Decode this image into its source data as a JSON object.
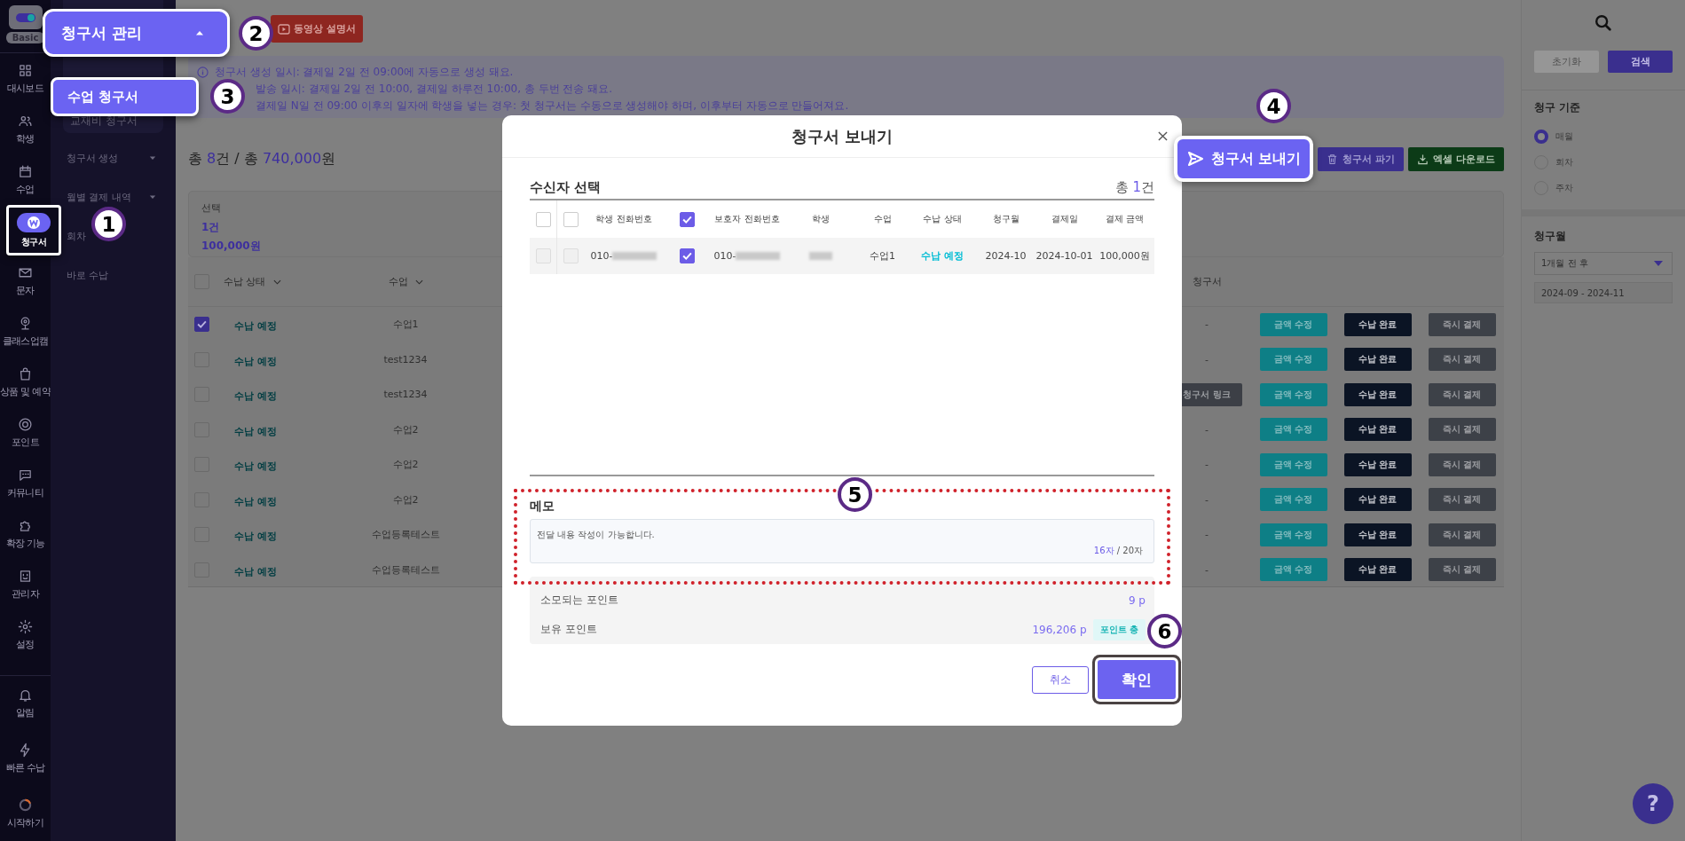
{
  "nav_rail": {
    "plan": "Basic",
    "items": [
      {
        "label": "대시보드",
        "selected": false
      },
      {
        "label": "학생",
        "selected": false
      },
      {
        "label": "수업",
        "selected": false
      },
      {
        "label": "청구서",
        "selected": true
      },
      {
        "label": "문자",
        "selected": false
      },
      {
        "label": "클래스업캠",
        "selected": false
      },
      {
        "label": "상품 및 예약",
        "selected": false
      },
      {
        "label": "포인트",
        "selected": false
      },
      {
        "label": "커뮤니티",
        "selected": false
      },
      {
        "label": "확장 기능",
        "selected": false
      },
      {
        "label": "관리자",
        "selected": false
      },
      {
        "label": "설정",
        "selected": false
      }
    ],
    "bottom_items": [
      {
        "label": "알림"
      },
      {
        "label": "빠른 수납"
      },
      {
        "label": "시작하기"
      }
    ]
  },
  "submenu": {
    "group": {
      "label": "청구서 관리",
      "expanded": true,
      "highlighted": true,
      "children": [
        {
          "label": "수업 청구서",
          "selected": true
        },
        {
          "label": "교재비 청구서",
          "selected": false
        }
      ]
    },
    "items": [
      {
        "label": "청구서 생성",
        "kind": "dropdown"
      },
      {
        "label": "월별 결제 내역",
        "kind": "dropdown"
      },
      {
        "label": "회차",
        "kind": "link"
      },
      {
        "label": "바로 수납",
        "kind": "link"
      }
    ]
  },
  "page": {
    "video_button": "동영상 설명서",
    "info_lines": [
      "청구서 생성 일시: 결제일 2일 전 09:00에 자동으로 생성 돼요.",
      "발송 일시: 결제일 2일 전 10:00, 결제일 하루전 10:00, 총 두번 전송 돼요.",
      "결제일 N일 전 09:00 이후의 일자에 학생을 넣는 경우: 첫 청구서는 수동으로 생성해야 하며, 이후부터 자동으로 만들어져요."
    ],
    "summary": [
      {
        "text": "총 ",
        "accent": false
      },
      {
        "text": "8",
        "accent": true
      },
      {
        "text": "건 / 총 ",
        "accent": false
      },
      {
        "text": "740,000",
        "accent": true
      },
      {
        "text": "원",
        "accent": false
      }
    ],
    "actions": [
      {
        "label": "청구서 보내기",
        "kind": "send",
        "highlighted": true
      },
      {
        "label": "청구서 파기",
        "kind": "delete",
        "highlighted": false
      },
      {
        "label": "엑셀 다운로드",
        "kind": "excel",
        "highlighted": false
      }
    ],
    "selection": {
      "title": "선택",
      "count": "1건",
      "amount": "100,000원"
    },
    "table": {
      "all_checked": false,
      "columns": [
        {
          "label": "수납 상태",
          "sortable": true
        },
        {
          "label": "수업",
          "sortable": true
        },
        {
          "label": "청구서",
          "sortable": false
        }
      ],
      "rows": [
        {
          "checked": true,
          "status": "수납 예정",
          "class": "수업1",
          "invoice": {
            "kind": "text",
            "text": "-"
          },
          "actions": [
            "금액 수정",
            "수납 완료",
            "즉시 결제"
          ]
        },
        {
          "checked": false,
          "status": "수납 예정",
          "class": "test1234",
          "invoice": {
            "kind": "text",
            "text": "-"
          },
          "actions": [
            "금액 수정",
            "수납 완료",
            "즉시 결제"
          ]
        },
        {
          "checked": false,
          "status": "수납 예정",
          "class": "test1234",
          "invoice": {
            "kind": "button",
            "text": "청구서 링크"
          },
          "actions": [
            "금액 수정",
            "수납 완료",
            "즉시 결제"
          ]
        },
        {
          "checked": false,
          "status": "수납 예정",
          "class": "수업2",
          "invoice": {
            "kind": "text",
            "text": "-"
          },
          "actions": [
            "금액 수정",
            "수납 완료",
            "즉시 결제"
          ]
        },
        {
          "checked": false,
          "status": "수납 예정",
          "class": "수업2",
          "invoice": {
            "kind": "text",
            "text": "-"
          },
          "actions": [
            "금액 수정",
            "수납 완료",
            "즉시 결제"
          ]
        },
        {
          "checked": false,
          "status": "수납 예정",
          "class": "수업2",
          "invoice": {
            "kind": "text",
            "text": "-"
          },
          "actions": [
            "금액 수정",
            "수납 완료",
            "즉시 결제"
          ]
        },
        {
          "checked": false,
          "status": "수납 예정",
          "class": "수업등록테스트",
          "invoice": {
            "kind": "text",
            "text": "-"
          },
          "actions": [
            "금액 수정",
            "수납 완료",
            "즉시 결제"
          ]
        },
        {
          "checked": false,
          "status": "수납 예정",
          "class": "수업등록테스트",
          "invoice": {
            "kind": "text",
            "text": "-"
          },
          "actions": [
            "금액 수정",
            "수납 완료",
            "즉시 결제"
          ]
        }
      ]
    }
  },
  "filters": {
    "reset": {
      "label": "초기화",
      "disabled": true
    },
    "search": "검색",
    "basis_title": "청구 기준",
    "basis_options": [
      {
        "label": "매월",
        "selected": true
      },
      {
        "label": "회차",
        "selected": false
      },
      {
        "label": "주차",
        "selected": false
      }
    ],
    "month_title": "청구월",
    "month_select": "1개월 전 후",
    "month_range": "2024-09 - 2024-11"
  },
  "modal": {
    "title": "청구서 보내기",
    "section_title": "수신자 선택",
    "total": [
      {
        "text": "총 ",
        "accent": false
      },
      {
        "text": "1",
        "accent": true
      },
      {
        "text": "건",
        "accent": false
      }
    ],
    "columns": [
      {
        "kind": "checkbox",
        "checked": false
      },
      {
        "kind": "checkbox",
        "checked": false
      },
      {
        "kind": "text",
        "label": "학생 전화번호"
      },
      {
        "kind": "checkbox",
        "checked": true
      },
      {
        "kind": "text",
        "label": "보호자 전화번호"
      },
      {
        "kind": "text",
        "label": "학생"
      },
      {
        "kind": "text",
        "label": "수업"
      },
      {
        "kind": "text",
        "label": "수납 상태"
      },
      {
        "kind": "text",
        "label": "청구월"
      },
      {
        "kind": "text",
        "label": "결제일"
      },
      {
        "kind": "text",
        "label": "결제 금액"
      }
    ],
    "rows": [
      [
        {
          "kind": "checkbox",
          "checked": false
        },
        {
          "kind": "checkbox",
          "checked": false
        },
        {
          "kind": "masked",
          "text": "010-"
        },
        {
          "kind": "checkbox",
          "checked": true
        },
        {
          "kind": "masked",
          "text": "010-"
        },
        {
          "kind": "masked"
        },
        {
          "kind": "text",
          "text": "수업1"
        },
        {
          "kind": "status",
          "text": "수납 예정"
        },
        {
          "kind": "text",
          "text": "2024-10"
        },
        {
          "kind": "text",
          "text": "2024-10-01"
        },
        {
          "kind": "text",
          "text": "100,000원"
        }
      ]
    ],
    "memo": {
      "label": "메모",
      "value": "전달 내용 작성이 가능합니다.",
      "used": "16자",
      "max": "/ 20자",
      "highlighted": true
    },
    "points": [
      {
        "label": "소모되는 포인트",
        "value": "9 p"
      },
      {
        "label": "보유 포인트",
        "value": "196,206 p",
        "button": "포인트 충"
      }
    ],
    "buttons": [
      {
        "label": "취소",
        "kind": "secondary",
        "highlighted": false
      },
      {
        "label": "확인",
        "kind": "primary",
        "highlighted": true
      }
    ]
  },
  "annotations": {
    "badges": [
      "1",
      "2",
      "3",
      "4",
      "5",
      "6"
    ]
  },
  "help": "?"
}
